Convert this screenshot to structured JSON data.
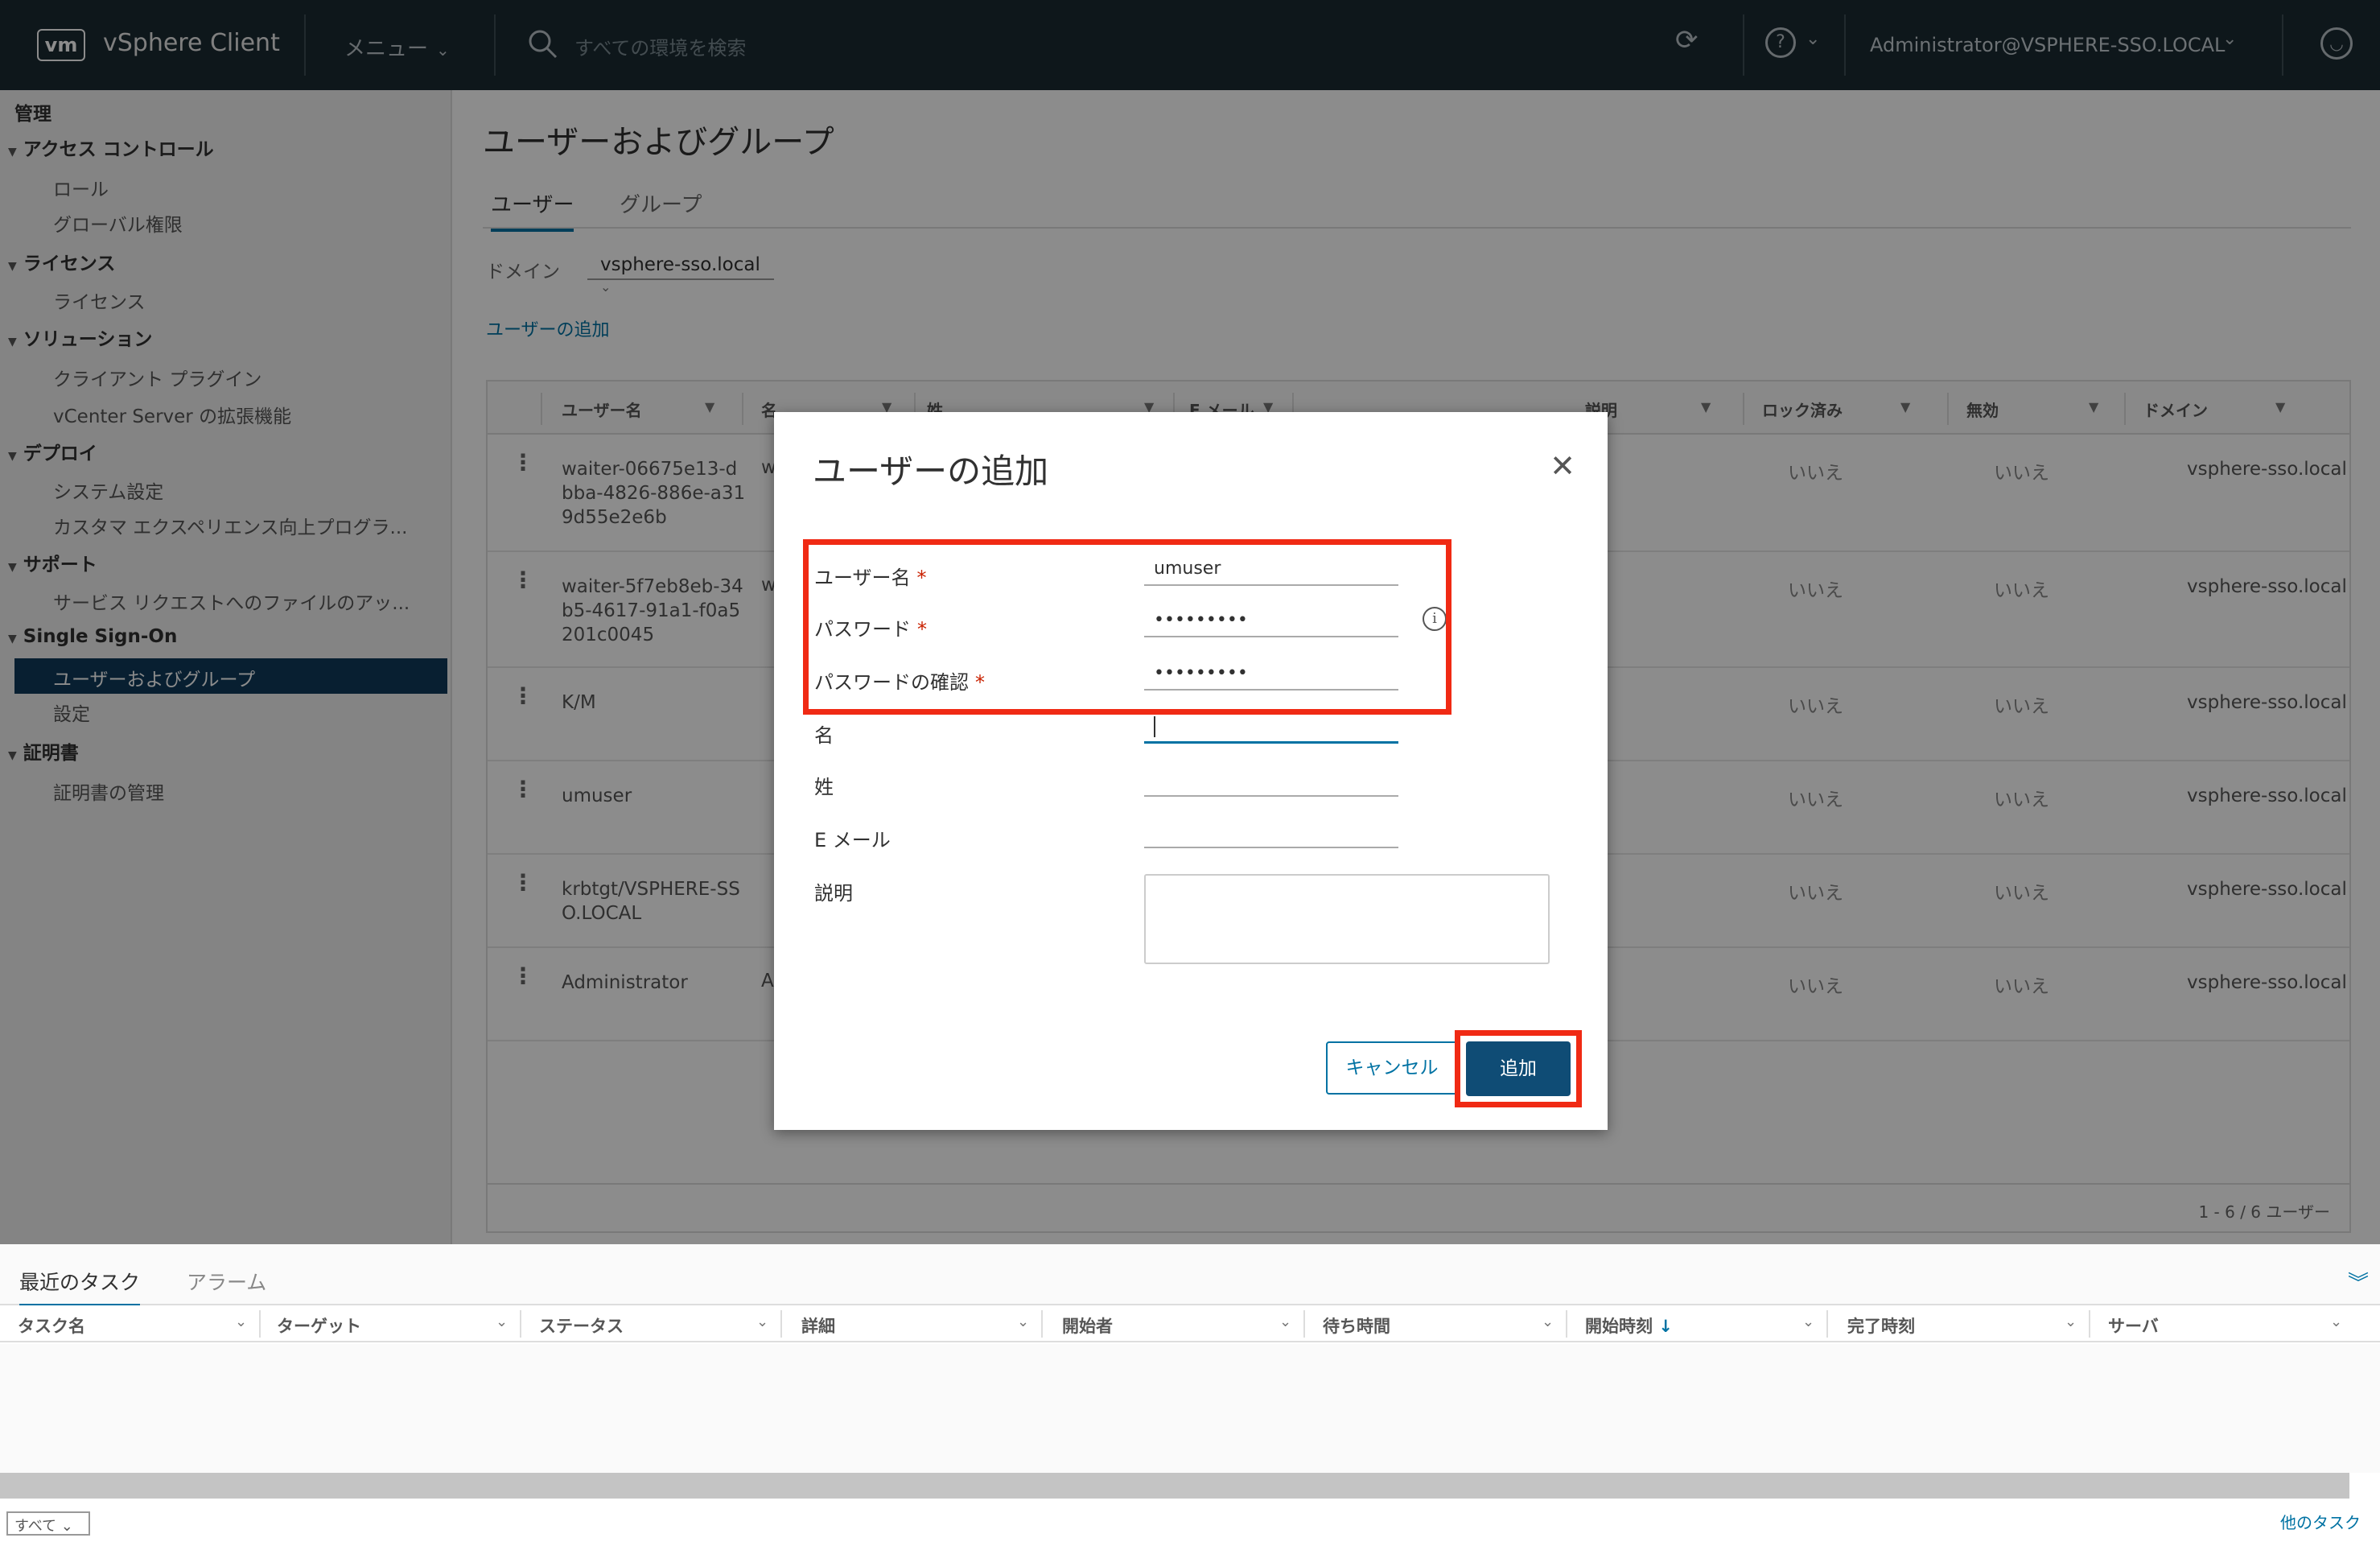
{
  "header": {
    "logo": "vm",
    "app_name": "vSphere Client",
    "menu_label": "メニュー",
    "search_placeholder": "すべての環境を検索",
    "user": "Administrator@VSPHERE-SSO.LOCAL"
  },
  "sidebar": {
    "title": "管理",
    "sections": [
      {
        "label": "アクセス コントロール",
        "items": [
          "ロール",
          "グローバル権限"
        ]
      },
      {
        "label": "ライセンス",
        "items": [
          "ライセンス"
        ]
      },
      {
        "label": "ソリューション",
        "items": [
          "クライアント プラグイン",
          "vCenter Server の拡張機能"
        ]
      },
      {
        "label": "デプロイ",
        "items": [
          "システム設定",
          "カスタマ エクスペリエンス向上プログラ..."
        ]
      },
      {
        "label": "サポート",
        "items": [
          "サービス リクエストへのファイルのアッ..."
        ]
      },
      {
        "label": "Single Sign-On",
        "items": [
          "ユーザーおよびグループ",
          "設定"
        ]
      },
      {
        "label": "証明書",
        "items": [
          "証明書の管理"
        ]
      }
    ]
  },
  "main": {
    "title": "ユーザーおよびグループ",
    "tabs": [
      "ユーザー",
      "グループ"
    ],
    "domain_label": "ドメイン",
    "domain_value": "vsphere-sso.local",
    "add_user_link": "ユーザーの追加",
    "columns": [
      "ユーザー名",
      "名",
      "姓",
      "E メール",
      "説明",
      "ロック済み",
      "無効",
      "ドメイン"
    ],
    "rows": [
      {
        "username": "waiter-06675e13-dbba-4826-886e-a319d55e2e6b",
        "first": "w",
        "locked": "いいえ",
        "disabled": "いいえ",
        "domain": "vsphere-sso.local"
      },
      {
        "username": "waiter-5f7eb8eb-34b5-4617-91a1-f0a5201c0045",
        "first": "w",
        "locked": "いいえ",
        "disabled": "いいえ",
        "domain": "vsphere-sso.local"
      },
      {
        "username": "K/M",
        "first": "",
        "locked": "いいえ",
        "disabled": "いいえ",
        "domain": "vsphere-sso.local"
      },
      {
        "username": "umuser",
        "first": "",
        "locked": "いいえ",
        "disabled": "いいえ",
        "domain": "vsphere-sso.local"
      },
      {
        "username": "krbtgt/VSPHERE-SSO.LOCAL",
        "first": "",
        "locked": "いいえ",
        "disabled": "いいえ",
        "domain": "vsphere-sso.local"
      },
      {
        "username": "Administrator",
        "first": "A",
        "locked": "いいえ",
        "disabled": "いいえ",
        "domain": "vsphere-sso.local"
      }
    ],
    "footer": "1 - 6 / 6 ユーザー"
  },
  "dialog": {
    "title": "ユーザーの追加",
    "fields": {
      "username_label": "ユーザー名",
      "username_value": "umuser",
      "password_label": "パスワード",
      "password_value": "•••••••••",
      "confirm_label": "パスワードの確認",
      "confirm_value": "•••••••••",
      "first_label": "名",
      "last_label": "姓",
      "email_label": "E メール",
      "desc_label": "説明"
    },
    "required_mark": "*",
    "cancel": "キャンセル",
    "add": "追加"
  },
  "bottom": {
    "tabs": [
      "最近のタスク",
      "アラーム"
    ],
    "columns": [
      "タスク名",
      "ターゲット",
      "ステータス",
      "詳細",
      "開始者",
      "待ち時間",
      "開始時刻",
      "完了時刻",
      "サーバ"
    ],
    "sort_indicator": "↓",
    "filter": "すべて",
    "more_tasks": "他のタスク"
  },
  "colors": {
    "header_bg": "#1b2a32",
    "accent": "#0072a3",
    "highlight": "#f02a14",
    "primary_button": "#0f4c75"
  }
}
